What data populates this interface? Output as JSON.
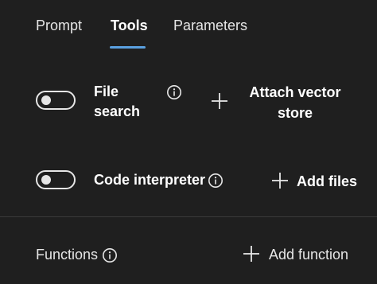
{
  "tabs": [
    {
      "label": "Prompt"
    },
    {
      "label": "Tools",
      "active": true
    },
    {
      "label": "Parameters"
    }
  ],
  "tools": {
    "file_search": {
      "line1": "File",
      "line2": "search",
      "enabled": false,
      "action_line1": "Attach vector",
      "action_line2": "store"
    },
    "code_interpreter": {
      "label": "Code interpreter",
      "enabled": false,
      "action": "Add files"
    }
  },
  "functions": {
    "label": "Functions",
    "action": "Add function"
  },
  "colors": {
    "background": "#1f1f1f",
    "active_tab_underline": "#5aa0e0",
    "divider": "#3a3a3a"
  }
}
